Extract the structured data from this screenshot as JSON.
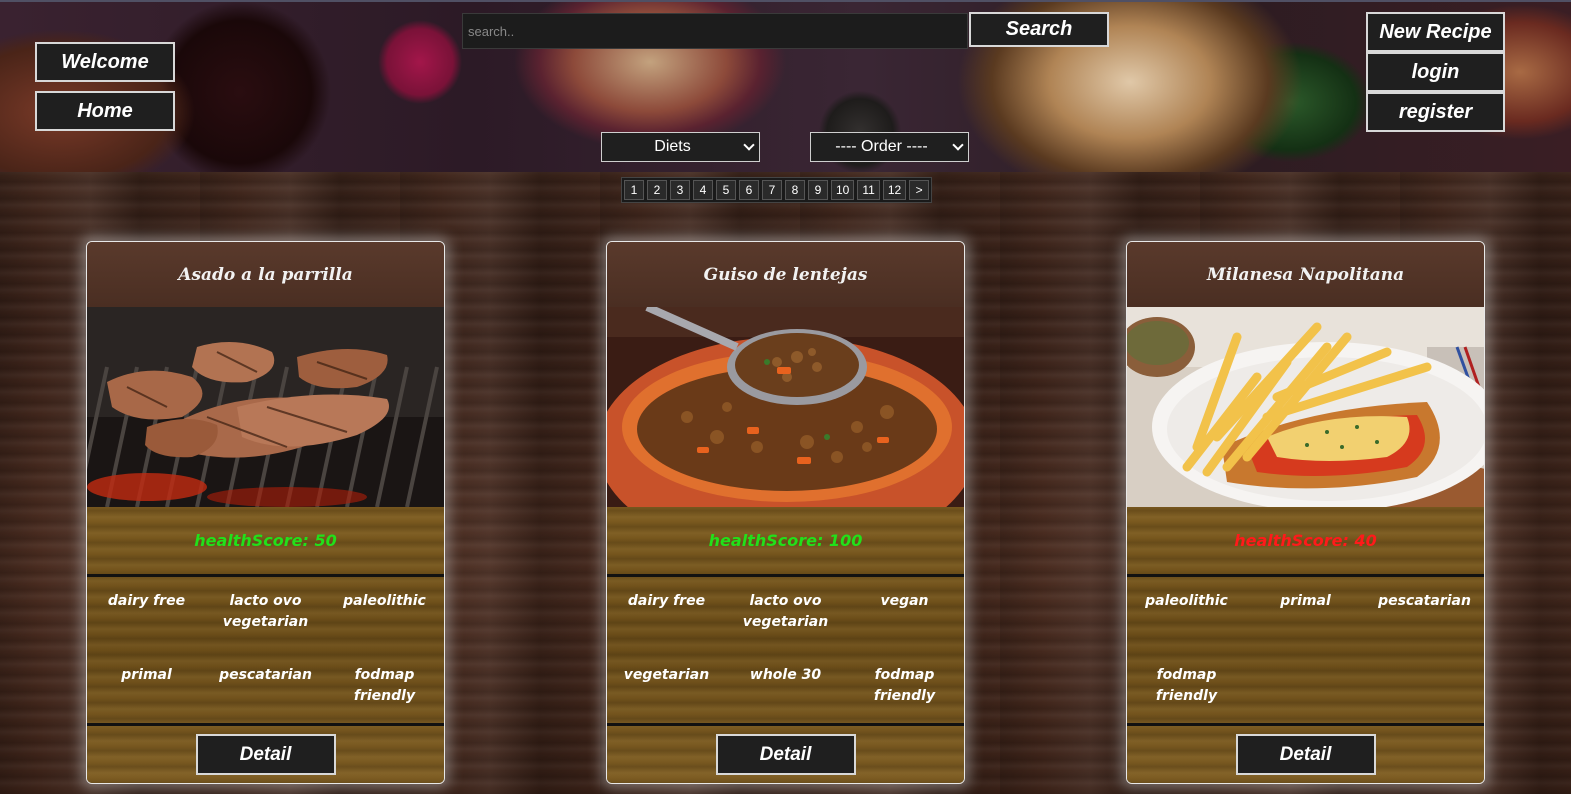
{
  "header": {
    "welcome_label": "Welcome",
    "home_label": "Home",
    "search_placeholder": "search..",
    "search_button": "Search",
    "new_recipe_label": "New Recipe",
    "login_label": "login",
    "register_label": "register",
    "diets_select": "Diets",
    "order_select": "---- Order ----"
  },
  "pagination": {
    "pages": [
      "1",
      "2",
      "3",
      "4",
      "5",
      "6",
      "7",
      "8",
      "9",
      "10",
      "11",
      "12"
    ],
    "next": ">"
  },
  "cards": [
    {
      "title": "Asado a la parrilla",
      "health": "healthScore: 50",
      "health_color": "#22e01a",
      "diets": [
        "dairy free",
        "lacto ovo vegetarian",
        "paleolithic",
        "primal",
        "pescatarian",
        "fodmap friendly"
      ],
      "detail": "Detail",
      "image_icon": "grilled-meat-image"
    },
    {
      "title": "Guiso de lentejas",
      "health": "healthScore: 100",
      "health_color": "#22e01a",
      "diets": [
        "dairy free",
        "lacto ovo vegetarian",
        "vegan",
        "vegetarian",
        "whole 30",
        "fodmap friendly"
      ],
      "detail": "Detail",
      "image_icon": "lentil-stew-image"
    },
    {
      "title": "Milanesa Napolitana",
      "health": "healthScore: 40",
      "health_color": "#ff1a1a",
      "diets": [
        "paleolithic",
        "primal",
        "pescatarian",
        "fodmap friendly"
      ],
      "detail": "Detail",
      "image_icon": "milanesa-image"
    }
  ]
}
